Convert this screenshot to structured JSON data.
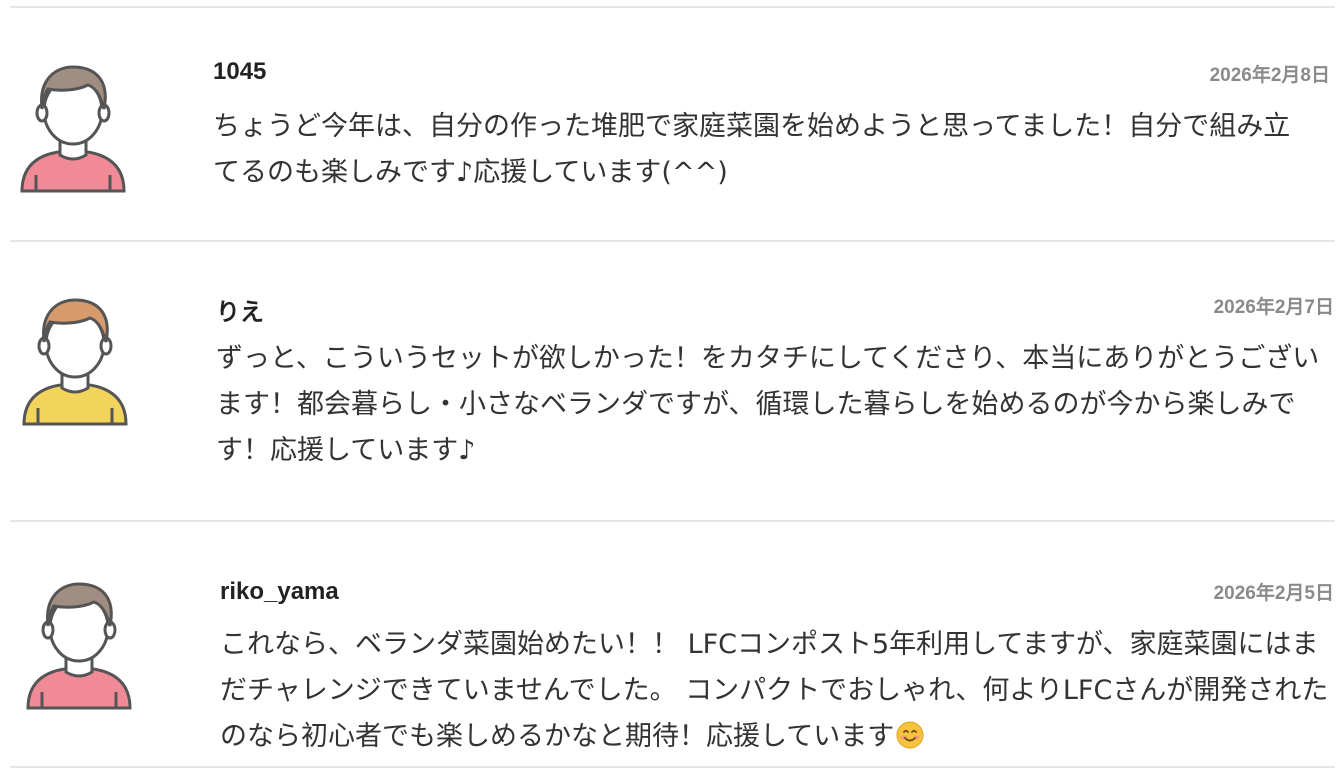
{
  "comments": [
    {
      "name": "1045",
      "date": "2026年2月8日",
      "text": "ちょうど今年は、自分の作った堆肥で家庭菜園を始めようと思ってました！自分で組み立てるのも楽しみです♪応援しています(^^)",
      "avatar_hair_color": "#a08e82",
      "avatar_shirt_color": "#f08a96"
    },
    {
      "name": "りえ",
      "date": "2026年2月7日",
      "text": "ずっと、こういうセットが欲しかった！をカタチにしてくださり、本当にありがとうございます！都会暮らし・小さなベランダですが、循環した暮らしを始めるのが今から楽しみです！応援しています♪",
      "avatar_hair_color": "#d79a6c",
      "avatar_shirt_color": "#f2d45c"
    },
    {
      "name": "riko_yama",
      "date": "2026年2月5日",
      "text": "これなら、ベランダ菜園始めたい！！ LFCコンポスト5年利用してますが、家庭菜園にはまだチャレンジできていませんでした。 コンパクトでおしゃれ、何よりLFCさんが開発されたのなら初心者でも楽しめるかなと期待！応援しています",
      "emoji": "smiling-face-icon",
      "avatar_hair_color": "#a08e82",
      "avatar_shirt_color": "#f08a96"
    }
  ]
}
